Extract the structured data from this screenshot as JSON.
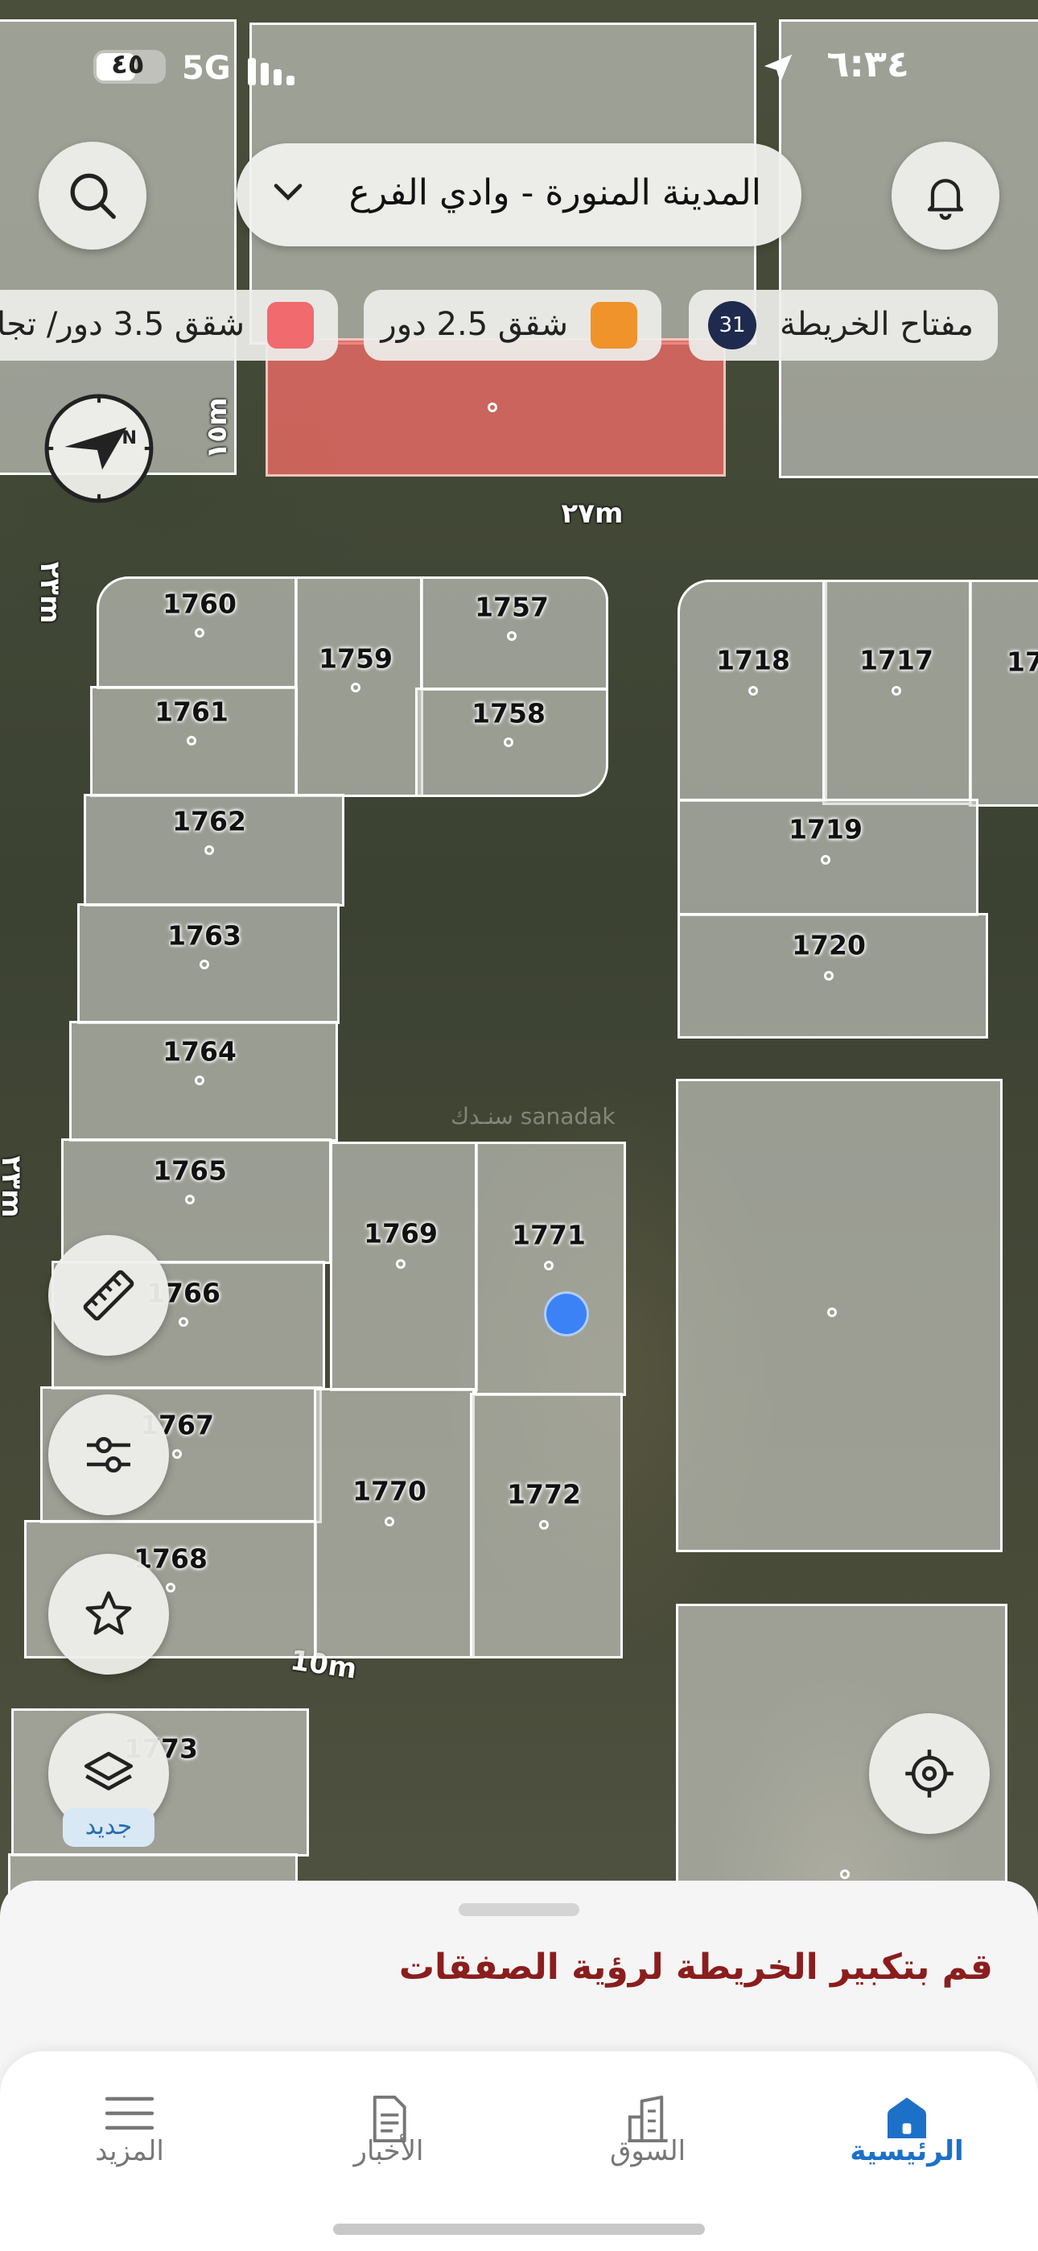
{
  "status_bar": {
    "time": "٦:٣٤",
    "network": "5G",
    "battery": "٤٥"
  },
  "header": {
    "city": "المدينة المنورة - وادي الفرع"
  },
  "legend": {
    "key_label": "مفتاح الخريطة",
    "key_count": "31",
    "item1_label": "شقق 2.5 دور",
    "item1_color": "#f0932b",
    "item2_label": "شقق 3.5 دور/ تجا",
    "item2_color": "#f06a6e"
  },
  "map": {
    "roads": [
      "١٥m",
      "٢٧m",
      "٢٣m",
      "٢٣m",
      "10m"
    ],
    "watermark": "سنـدك sanadak",
    "plots": [
      "1760",
      "1757",
      "1759",
      "1761",
      "1758",
      "1762",
      "1763",
      "1764",
      "1765",
      "1766",
      "1767",
      "1768",
      "1769",
      "1770",
      "1771",
      "1772",
      "1773",
      "1718",
      "1717",
      "17",
      "1719",
      "1720"
    ]
  },
  "map_controls": {
    "new_badge": "جديد"
  },
  "sheet": {
    "message": "قم بتكبير الخريطة لرؤية الصفقات"
  },
  "tabs": {
    "home": "الرئيسية",
    "market": "السوق",
    "news": "الأخبار",
    "more": "المزيد"
  },
  "colors": {
    "accent": "#1d70c8",
    "message": "#8b1d1d",
    "location_dot": "#3b82f6"
  }
}
